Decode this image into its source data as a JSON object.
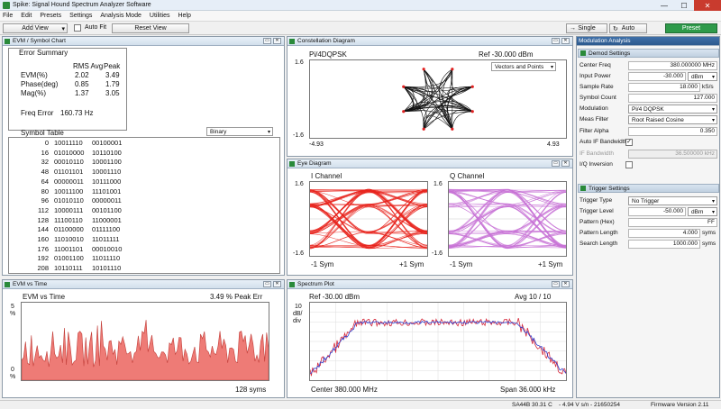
{
  "window": {
    "title": "Spike: Signal Hound Spectrum Analyzer Software",
    "min": "—",
    "max": "☐",
    "close": "✕"
  },
  "menu": [
    "File",
    "Edit",
    "Presets",
    "Settings",
    "Analysis Mode",
    "Utilities",
    "Help"
  ],
  "toolbar": {
    "add_view": "Add View",
    "auto_fit": "Auto Fit",
    "reset_view": "Reset View",
    "single": "Single",
    "auto": "Auto",
    "preset": "Preset"
  },
  "evm": {
    "title": "EVM / Symbol Chart",
    "summary": "Error Summary",
    "col_rms": "RMS Avg",
    "col_peak": "Peak",
    "rows": [
      {
        "name": "EVM(%)",
        "rms": "2.02",
        "peak": "3.49"
      },
      {
        "name": "Phase(deg)",
        "rms": "0.85",
        "peak": "1.79"
      },
      {
        "name": "Mag(%)",
        "rms": "1.37",
        "peak": "3.05"
      }
    ],
    "freq_error_label": "Freq Error",
    "freq_error": "160.73 Hz",
    "symbol_table": "Symbol Table",
    "format": "Binary",
    "symbols": [
      [
        "0",
        "10011110",
        "00100001"
      ],
      [
        "16",
        "01010000",
        "10110100"
      ],
      [
        "32",
        "00010110",
        "10001100"
      ],
      [
        "48",
        "01101101",
        "10001110"
      ],
      [
        "64",
        "00000011",
        "10111000"
      ],
      [
        "80",
        "10011100",
        "11101001"
      ],
      [
        "96",
        "01010110",
        "00000011"
      ],
      [
        "112",
        "10000111",
        "00101100"
      ],
      [
        "128",
        "11100110",
        "11000001"
      ],
      [
        "144",
        "01100000",
        "01111100"
      ],
      [
        "160",
        "11010010",
        "11011111"
      ],
      [
        "176",
        "11001101",
        "00010010"
      ],
      [
        "192",
        "01001100",
        "11011110"
      ],
      [
        "208",
        "10110111",
        "10101110"
      ]
    ]
  },
  "constellation": {
    "title": "Constellation Diagram",
    "mod": "Pi/4DQPSK",
    "ref": "Ref -30.000 dBm",
    "mode": "Vectors and Points",
    "ytop": "1.6",
    "ybot": "-1.6",
    "xleft": "-4.93",
    "xright": "4.93"
  },
  "eye": {
    "title": "Eye Diagram",
    "i_title": "I Channel",
    "q_title": "Q Channel",
    "ytop": "1.6",
    "ybot": "-1.6",
    "xleft": "-1 Sym",
    "xright": "+1 Sym",
    "i_color": "#e8231c",
    "q_color": "#c873d6"
  },
  "evm_time": {
    "title": "EVM vs Time",
    "plot_title": "EVM vs Time",
    "peak": "3.49 % Peak Err",
    "ytop": "5",
    "yunit": "%",
    "ybot": "0",
    "yunit2": "%",
    "syms": "128 syms",
    "color": "#ee7b76"
  },
  "spectrum": {
    "title": "Spectrum Plot",
    "ref": "Ref -30.00 dBm",
    "avg": "Avg 10 / 10",
    "scale_val": "10",
    "scale_unit": "dB/",
    "scale_div": "div",
    "center": "Center 380.000 MHz",
    "span": "Span 36.000 kHz",
    "trace1": "#d6283a",
    "trace2": "#2c3fd0"
  },
  "modanalysis": {
    "title": "Modulation Analysis",
    "demod": "Demod Settings",
    "trigger": "Trigger Settings",
    "demod_rows": [
      {
        "label": "Center Freq",
        "value": "380.000000 MHz"
      },
      {
        "label": "Input Power",
        "value": "-30.000",
        "unit": "dBm"
      },
      {
        "label": "Sample Rate",
        "value": "18.000",
        "unit2": "kS/s"
      },
      {
        "label": "Symbol Count",
        "value": "127.000"
      },
      {
        "label": "Modulation",
        "value": "Pi/4 DQPSK"
      },
      {
        "label": "Meas Filter",
        "value": "Root Raised Cosine"
      },
      {
        "label": "Filter Alpha",
        "value": "0.350"
      }
    ],
    "auto_if": "Auto IF Bandwidth",
    "if_bw_label": "IF Bandwidth",
    "if_bw": "36.500000 kHz",
    "iq_inv": "I/Q Inversion",
    "trig_rows": [
      {
        "label": "Trigger Type",
        "value": "No Trigger"
      },
      {
        "label": "Trigger Level",
        "value": "-50.000",
        "unit": "dBm"
      },
      {
        "label": "Pattern (Hex)",
        "value": "FF"
      },
      {
        "label": "Pattern Length",
        "value": "4.000",
        "unit2": "syms"
      },
      {
        "label": "Search Length",
        "value": "1000.000",
        "unit2": "syms"
      }
    ]
  },
  "status": {
    "device": "SA44B",
    "temp": "30.31 C",
    "volt": "-  4.94 V s/n - 21650254",
    "fw": "Firmware Version 2.11"
  }
}
